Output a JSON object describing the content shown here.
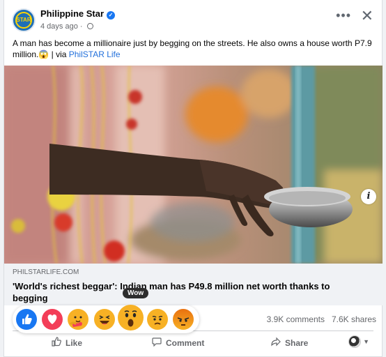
{
  "post": {
    "page_name": "Philippine Star",
    "logo_text": "PHILIPPINE STAR",
    "logo_short": "STAR",
    "time": "4 days ago",
    "separator": "·",
    "message_main": "A man has become a millionaire just by begging on the streets. He also owns a house worth P7.9 million.😱 | via ",
    "message_link": "PhilSTAR Life",
    "more_icon": "more-options-icon",
    "close_icon": "close-icon"
  },
  "preview": {
    "domain": "PHILSTARLIFE.COM",
    "title": "'World's richest beggar': Indian man has P49.8 million net worth thanks to begging",
    "info_icon": "i"
  },
  "reactions": {
    "tooltip": "Wow",
    "items": [
      "like",
      "love",
      "care",
      "haha",
      "wow",
      "sad",
      "angry"
    ]
  },
  "stats": {
    "comments": "3.9K comments",
    "shares": "7.6K shares"
  },
  "actions": {
    "like": "Like",
    "comment": "Comment",
    "share": "Share"
  },
  "colors": {
    "accent": "#1877f2",
    "link": "#216fdb",
    "muted": "#65676b"
  }
}
